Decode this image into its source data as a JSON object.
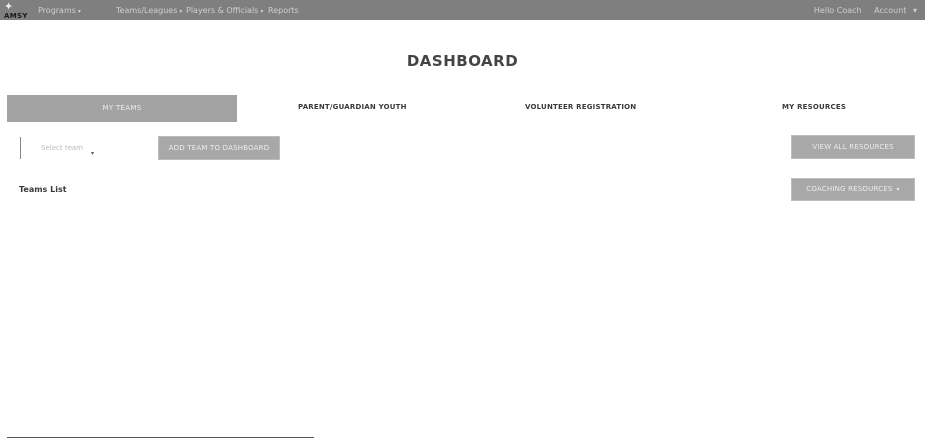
{
  "header": {
    "logo_text": "AMSY",
    "nav": [
      {
        "label": "Programs"
      },
      {
        "label": "Teams/Leagues"
      },
      {
        "label": "Players & Officials"
      },
      {
        "label": "Reports"
      }
    ],
    "user": {
      "name": "Hello Coach",
      "extra": "Account"
    }
  },
  "page": {
    "title": "DASHBOARD"
  },
  "tabs": [
    {
      "label": "MY TEAMS",
      "active": true
    },
    {
      "label": "PARENT/GUARDIAN YOUTH",
      "active": false
    },
    {
      "label": "VOLUNTEER REGISTRATION",
      "active": false
    },
    {
      "label": "MY RESOURCES",
      "active": false
    }
  ],
  "my_teams": {
    "org_select_value": "Select team",
    "add_button": "ADD TEAM TO DASHBOARD",
    "teams_list_label": "Teams List"
  },
  "resources": {
    "button_1": "VIEW ALL RESOURCES",
    "button_2": "COACHING RESOURCES"
  },
  "colors": {
    "topbar_bg": "#7f7f7f",
    "active_tab_bg": "#a3a3a3",
    "button_bg": "#a8a8a8"
  }
}
